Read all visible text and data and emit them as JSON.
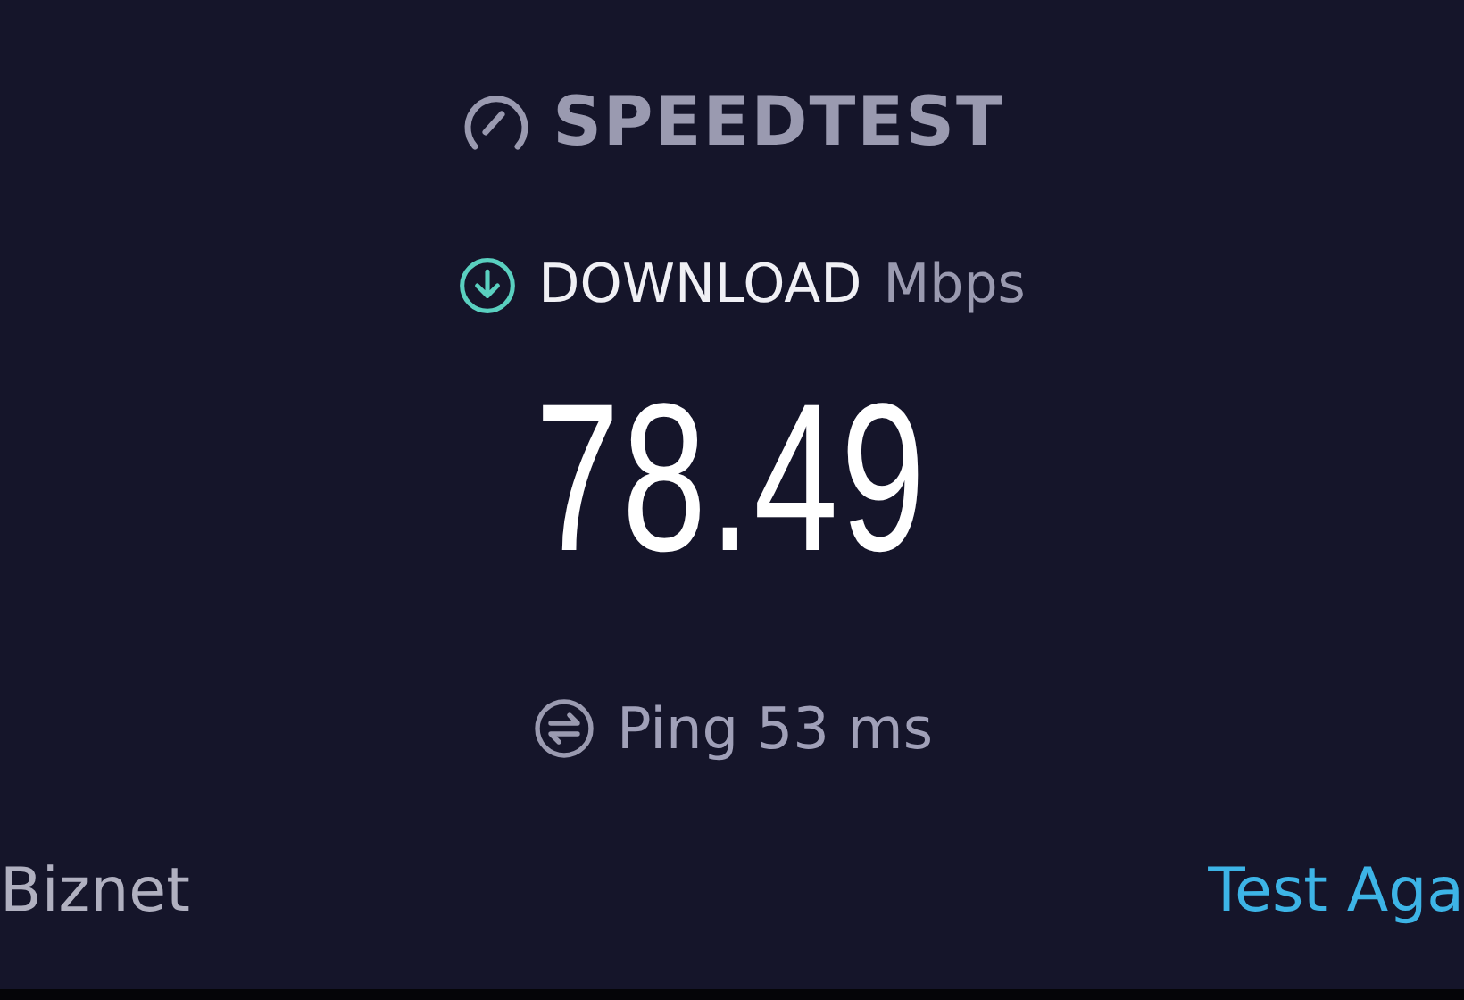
{
  "app": {
    "logo": "SPEEDTEST"
  },
  "result": {
    "label": "DOWNLOAD",
    "unit": "Mbps",
    "value": "78.49"
  },
  "ping": {
    "label": "Ping 53 ms"
  },
  "footer": {
    "provider": "Biznet",
    "action": "Test Aga"
  }
}
